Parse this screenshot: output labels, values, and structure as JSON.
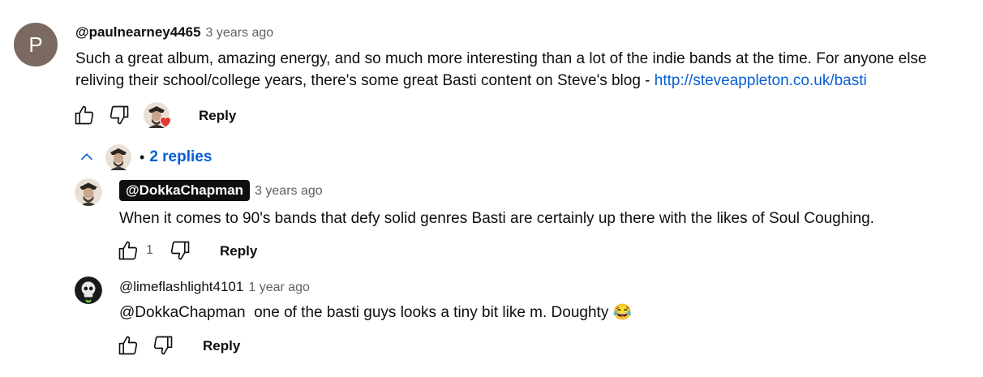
{
  "comment": {
    "avatar_letter": "P",
    "author": "@paulnearney4465",
    "time": "3 years ago",
    "text_line1": "Such a great album, amazing energy, and so much more interesting than a lot of the indie bands at the time. For anyone else",
    "text_line2": "reliving their school/college years, there's some great Basti content on Steve's blog - ",
    "link": "http://steveappleton.co.uk/basti",
    "reply_label": "Reply"
  },
  "replies_toggle": {
    "label": "2 replies",
    "dot": "•"
  },
  "replies": [
    {
      "author": "@DokkaChapman",
      "time": "3 years ago",
      "text": "When it comes to 90's bands that defy solid genres Basti are certainly up there with the likes of Soul Coughing.",
      "likes": "1",
      "reply_label": "Reply"
    },
    {
      "author": "@limeflashlight4101",
      "time": "1 year ago",
      "text": "@DokkaChapman  one of the basti guys looks a tiny bit like m. Doughty 😂",
      "reply_label": "Reply"
    }
  ],
  "colors": {
    "link": "#065fd4",
    "heart": "#e53935",
    "avatar_bg": "#7b6a5f"
  }
}
